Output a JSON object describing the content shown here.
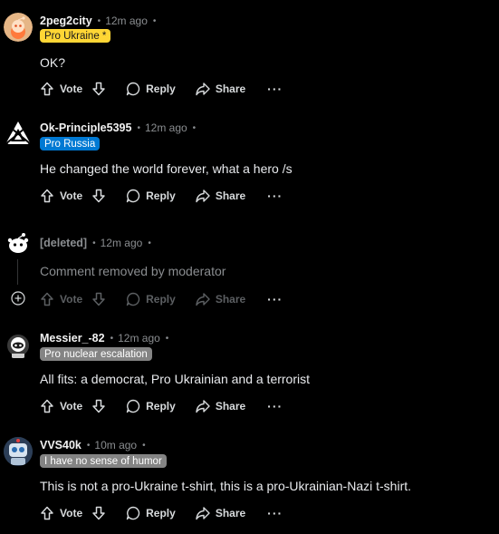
{
  "comments": [
    {
      "username": "2peg2city",
      "time": "12m ago",
      "flair": "Pro Ukraine *",
      "flair_bg": "#ffd635",
      "flair_fg": "#1a1a1b",
      "body": "OK?",
      "avatar": "snoo-orange-avatar"
    },
    {
      "username": "Ok-Principle5395",
      "time": "12m ago",
      "flair": "Pro Russia",
      "flair_bg": "#0079d3",
      "flair_fg": "#ffffff",
      "body": "He changed the world forever, what a hero /s",
      "avatar": "triangle-logo-avatar"
    },
    {
      "username": "[deleted]",
      "time": "12m ago",
      "body": "Comment removed by moderator",
      "avatar": "deleted-snoo-avatar"
    },
    {
      "username": "Messier_-82",
      "time": "12m ago",
      "flair": "Pro nuclear escalation",
      "flair_bg": "#848484",
      "flair_fg": "#ffffff",
      "body": "All fits: a democrat, Pro Ukrainian and a terrorist",
      "avatar": "astronaut-avatar"
    },
    {
      "username": "VVS40k",
      "time": "10m ago",
      "flair": "I have no sense of humor",
      "flair_bg": "#848484",
      "flair_fg": "#ffffff",
      "body": "This is not a pro-Ukraine t-shirt, this is a pro-Ukrainian-Nazi t-shirt.",
      "avatar": "robot-avatar"
    }
  ],
  "actions": {
    "vote": "Vote",
    "reply": "Reply",
    "share": "Share",
    "more": "···"
  },
  "colors": {
    "background": "#000000",
    "meta": "#8a8d90",
    "text": "#e8eaed"
  }
}
